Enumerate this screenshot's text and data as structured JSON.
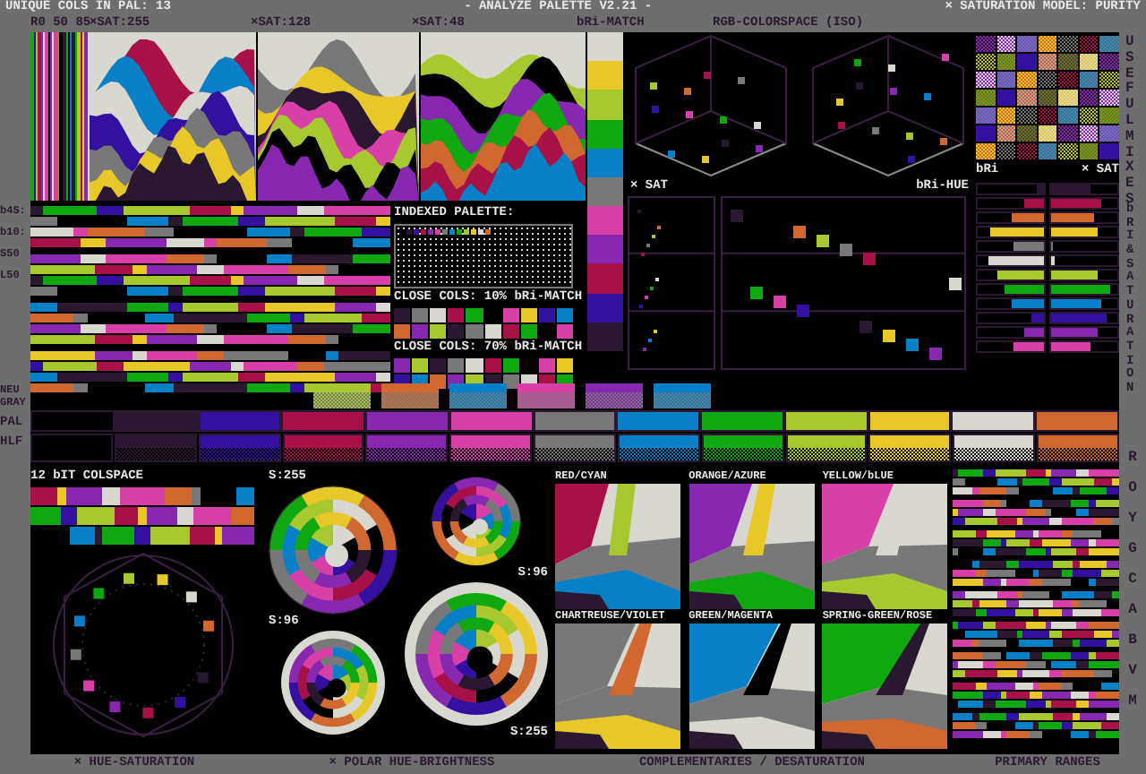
{
  "header": {
    "unique_count": "UNIQUE COLS IN PAL: 13",
    "title": "- ANALYZE PALETTE V2.21 -",
    "model": "× SATURATION MODEL: PURITY"
  },
  "subheader": {
    "levels": "R0 50 85",
    "sat_labels": [
      "×SAT:255",
      "×SAT:128",
      "×SAT:48"
    ],
    "bri_match": "bRi-MATCH",
    "rgb": "RGB-COLORSPACE (ISO)"
  },
  "palette": [
    {
      "color": "#000000"
    },
    {
      "color": "#2a1830"
    },
    {
      "color": "#3410a0"
    },
    {
      "color": "#a81048"
    },
    {
      "color": "#8828b0"
    },
    {
      "color": "#d840a8"
    },
    {
      "color": "#787878"
    },
    {
      "color": "#0880c8"
    },
    {
      "color": "#10a810"
    },
    {
      "color": "#a8c830"
    },
    {
      "color": "#e8c828"
    },
    {
      "color": "#d8d8d0"
    },
    {
      "color": "#d06830"
    }
  ],
  "stripe_labels": [
    "b4S:",
    "b10:",
    "S50",
    "L50"
  ],
  "indexed_palette": {
    "title": "INDEXED PALETTE:"
  },
  "close_cols": [
    "CLOSE COLS: 10% bRi-MATCH",
    "CLOSE COLS: 70% bRi-MATCH"
  ],
  "scatter": {
    "sat_title": "× SAT",
    "bri_hue_title": "bRi-HUE"
  },
  "side_labels": [
    "USEFUL MIXES",
    "bRI & SATURATION"
  ],
  "bri_sat": {
    "bri_title": "bRi",
    "sat_title": "× SAT",
    "rows": [
      {
        "color": "#2a1830",
        "bri": {
          "level": 0.1
        },
        "sat": {
          "level": 0.6
        }
      },
      {
        "color": "#a81048",
        "bri": {
          "level": 0.3
        },
        "sat": {
          "level": 0.75
        }
      },
      {
        "color": "#d06830",
        "bri": {
          "level": 0.5
        },
        "sat": {
          "level": 0.65
        }
      },
      {
        "color": "#e8c828",
        "bri": {
          "level": 0.8
        },
        "sat": {
          "level": 0.7
        }
      },
      {
        "color": "#787878",
        "bri": {
          "level": 0.45
        },
        "sat": {
          "level": 0.03
        }
      },
      {
        "color": "#d8d8d0",
        "bri": {
          "level": 0.85
        },
        "sat": {
          "level": 0.05
        }
      },
      {
        "color": "#a8c830",
        "bri": {
          "level": 0.7
        },
        "sat": {
          "level": 0.7
        }
      },
      {
        "color": "#10a810",
        "bri": {
          "level": 0.6
        },
        "sat": {
          "level": 0.9
        }
      },
      {
        "color": "#0880c8",
        "bri": {
          "level": 0.5
        },
        "sat": {
          "level": 0.75
        }
      },
      {
        "color": "#3410a0",
        "bri": {
          "level": 0.2
        },
        "sat": {
          "level": 0.85
        }
      },
      {
        "color": "#8828b0",
        "bri": {
          "level": 0.3
        },
        "sat": {
          "level": 0.7
        }
      },
      {
        "color": "#d840a8",
        "bri": {
          "level": 0.45
        },
        "sat": {
          "level": 0.6
        }
      }
    ]
  },
  "row_labels": [
    "NEU GRAY",
    "PAL",
    "HLF"
  ],
  "colspace_title": "12 bIT COLSPACE",
  "polar_labels": [
    "S:255",
    "S:96",
    "S:96",
    "S:255"
  ],
  "complementaries": [
    "RED/CYAN",
    "ORANGE/AZURE",
    "YELLOW/bLUE",
    "CHARTREUSE/VIOLET",
    "GREEN/MAGENTA",
    "SPRING-GREEN/ROSE"
  ],
  "primary_ranges": [
    "R",
    "O",
    "Y",
    "G",
    "C",
    "A",
    "B",
    "V",
    "M"
  ],
  "footer": [
    "× HUE-SATURATION",
    "× POLAR HUE-BRIGHTNESS",
    "COMPLEMENTARIES / DESATURATION",
    "PRIMARY RANGES"
  ]
}
